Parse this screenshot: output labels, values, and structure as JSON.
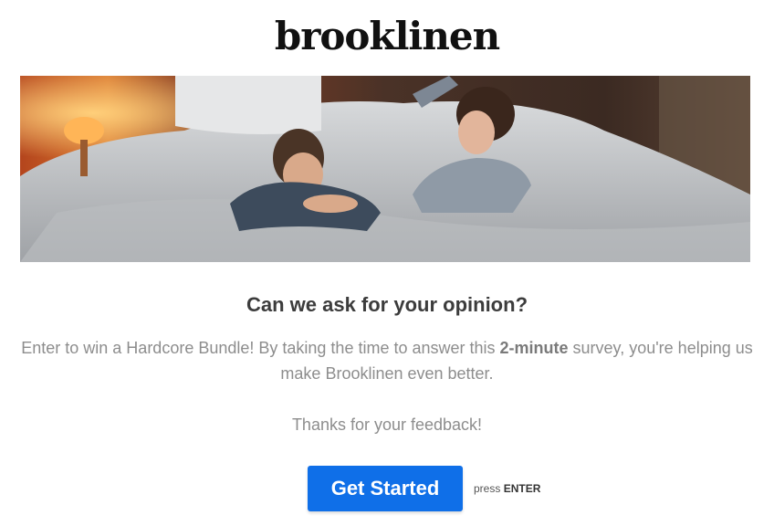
{
  "brand": {
    "logo_text": "brooklinen"
  },
  "hero": {
    "image": "couple-lying-on-grey-bed-photo"
  },
  "survey": {
    "headline": "Can we ask for your opinion?",
    "description_before": "Enter to win a Hardcore Bundle! By taking the time to answer this ",
    "description_emphasis": "2-minute",
    "description_after": " survey, you're helping us make Brooklinen even better.",
    "thanks": "Thanks for your feedback!"
  },
  "cta": {
    "button_label": "Get Started",
    "hint_prefix": "press",
    "hint_key": "ENTER"
  },
  "colors": {
    "accent": "#0f6fe8",
    "heading": "#3c3c3c",
    "body_text": "#8d8d8d"
  }
}
